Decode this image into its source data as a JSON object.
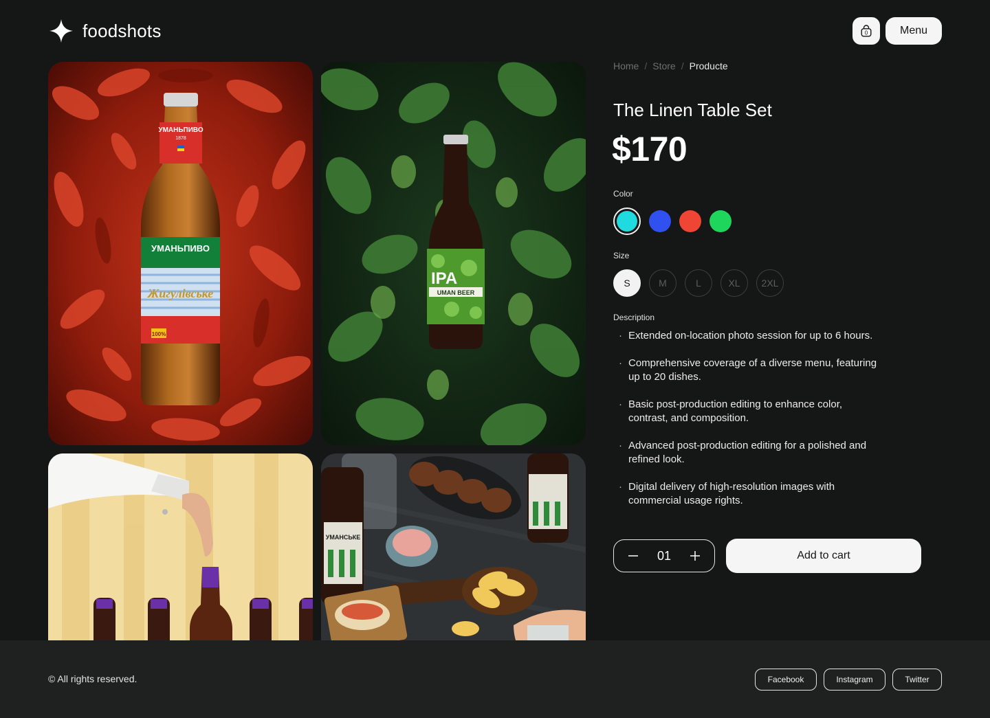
{
  "header": {
    "brand": "foodshots",
    "cart_count": "0",
    "menu_label": "Menu"
  },
  "gallery": {
    "tile1": {
      "cap_brand": "УМАНЬПИВО",
      "cap_year": "1878",
      "label_brand": "УМАНЬПИВО",
      "label_name": "Жигулівське",
      "label_pct": "100%"
    },
    "tile2": {
      "label_big": "IPA",
      "label_sub": "UMAN BEER"
    },
    "tile4": {
      "label_brand": "УМАНСЬКЕ"
    }
  },
  "breadcrumb": [
    "Home",
    "Store",
    "Producte"
  ],
  "product": {
    "title": "The Linen Table Set",
    "price": "$170"
  },
  "color": {
    "label": "Color",
    "options": [
      "#1fdbe0",
      "#3150f0",
      "#ef4534",
      "#1fd65c"
    ],
    "selected": 0
  },
  "size": {
    "label": "Size",
    "options": [
      "S",
      "M",
      "L",
      "XL",
      "2XL"
    ],
    "selected": 0
  },
  "description": {
    "label": "Description",
    "items": [
      "Extended on-location photo session for up to 6 hours.",
      "Comprehensive coverage of a diverse menu, featuring up to 20 dishes.",
      "Basic post-production editing to enhance color, contrast, and composition.",
      "Advanced post-production editing for a polished and refined look.",
      "Digital delivery of high-resolution images with commercial usage rights."
    ]
  },
  "purchase": {
    "quantity": "01",
    "add_to_cart": "Add to cart"
  },
  "footer": {
    "copyright": "© All rights reserved.",
    "social": [
      "Facebook",
      "Instagram",
      "Twitter"
    ]
  }
}
